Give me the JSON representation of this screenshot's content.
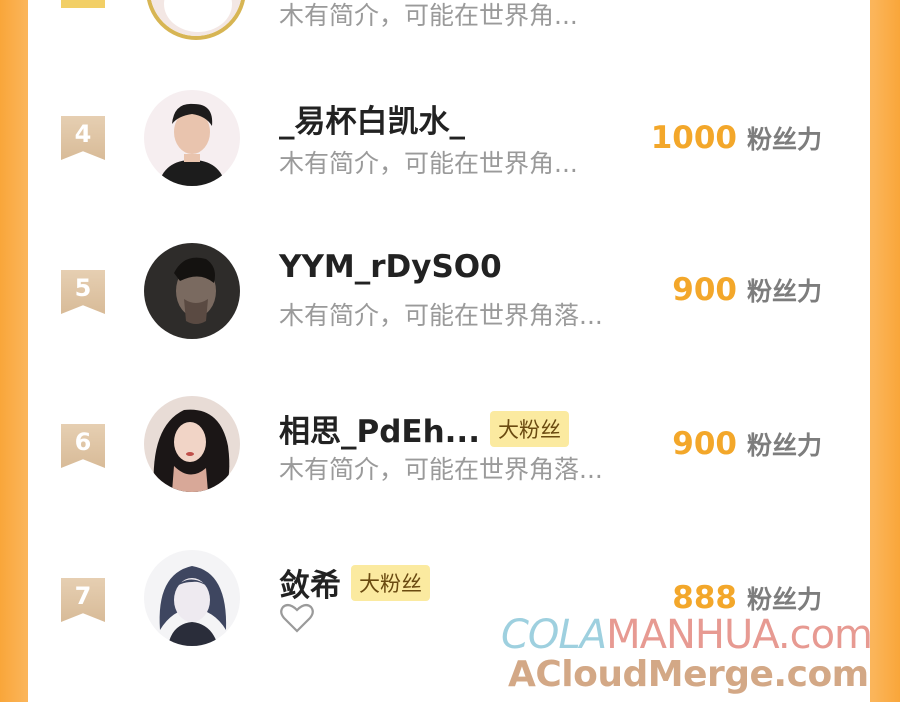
{
  "rows": [
    {
      "rank": "",
      "name": "",
      "badge": "",
      "bio": "木有简介，可能在世界角...",
      "score": "",
      "score_unit": ""
    },
    {
      "rank": "4",
      "name": "_易杯白凯水_",
      "badge": "",
      "bio": "木有简介，可能在世界角...",
      "score": "1000",
      "score_unit": "粉丝力"
    },
    {
      "rank": "5",
      "name": "YYM_rDySO0",
      "badge": "",
      "bio": "木有简介，可能在世界角落...",
      "score": "900",
      "score_unit": "粉丝力"
    },
    {
      "rank": "6",
      "name": "相思_PdEh...",
      "badge": "大粉丝",
      "bio": "木有简介，可能在世界角落...",
      "score": "900",
      "score_unit": "粉丝力"
    },
    {
      "rank": "7",
      "name": "敛希",
      "badge": "大粉丝",
      "bio": "",
      "score": "888",
      "score_unit": "粉丝力"
    }
  ],
  "watermark": {
    "line1_a": "COLA",
    "line1_b": "MANHUA.com",
    "line2": "ACloudMerge.com"
  },
  "colors": {
    "frame": "#fab04a",
    "score": "#f3a72a",
    "badge_bg": "#fbeaa0",
    "rank_badge": "#dcc2a2"
  },
  "icons": [
    "ranking-ribbon-icon",
    "heart-outline-icon"
  ]
}
